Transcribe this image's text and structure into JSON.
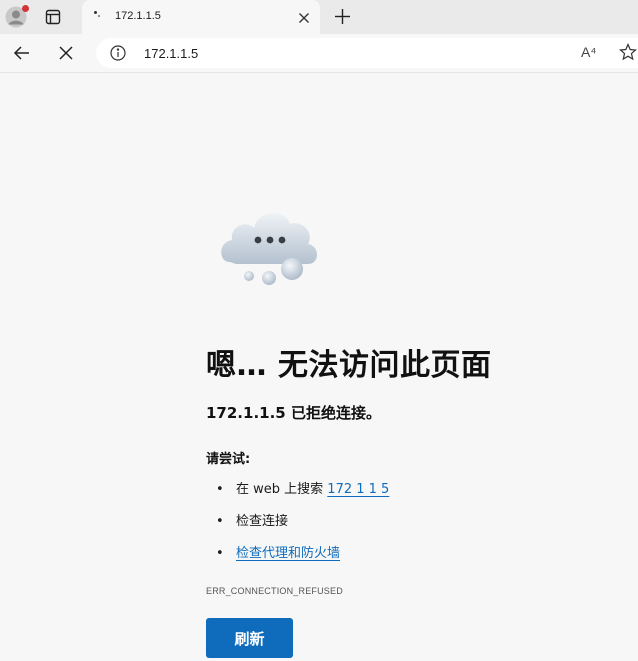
{
  "browser": {
    "tab": {
      "title": "172.1.1.5"
    },
    "address_bar": {
      "url": "172.1.1.5"
    },
    "read_aloud_label": "A⁴"
  },
  "error_page": {
    "heading": "嗯… 无法访问此页面",
    "subheading": "172.1.1.5 已拒绝连接。",
    "try_label": "请尝试:",
    "suggestions": {
      "search_prefix": "在 web 上搜索",
      "search_link": "172 1 1 5",
      "check_connection": "检查连接",
      "check_proxy": "检查代理和防火墙"
    },
    "bullet": "•",
    "error_code": "ERR_CONNECTION_REFUSED",
    "refresh_label": "刷新"
  },
  "colors": {
    "accent": "#0f6cbd",
    "page_bg": "#f7f7f7",
    "tabstrip_bg": "#eaeaea",
    "notification_dot": "#d13438"
  }
}
